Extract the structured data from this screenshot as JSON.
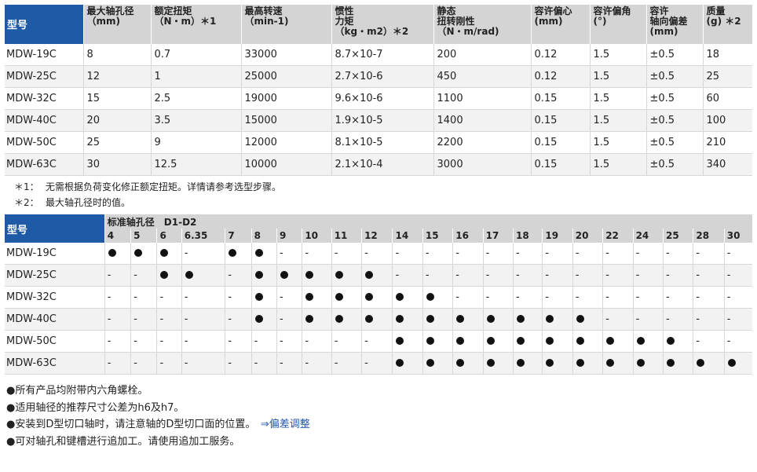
{
  "spec_table": {
    "headers": [
      {
        "line1": "型号",
        "line2": ""
      },
      {
        "line1": "最大轴孔径",
        "line2": "（mm)"
      },
      {
        "line1": "额定扭矩",
        "line2": "（N・m）＊1"
      },
      {
        "line1": "最高转速",
        "line2": "（min-1)"
      },
      {
        "line1": "惯性",
        "line2": "力矩",
        "line3": "（kg・m2）＊2"
      },
      {
        "line1": "静态",
        "line2": "扭转刚性",
        "line3": "（N・m/rad)"
      },
      {
        "line1": "容许偏心",
        "line2": "(mm)"
      },
      {
        "line1": "容许偏角",
        "line2": "(°)"
      },
      {
        "line1": "容许",
        "line2": "轴向偏差",
        "line3": "(mm)"
      },
      {
        "line1": "质量",
        "line2": "(g) ＊2"
      }
    ],
    "rows": [
      [
        "MDW-19C",
        "8",
        "0.7",
        "33000",
        "8.7×10-7",
        "200",
        "0.12",
        "1.5",
        "±0.5",
        "18"
      ],
      [
        "MDW-25C",
        "12",
        "1",
        "25000",
        "2.7×10-6",
        "450",
        "0.12",
        "1.5",
        "±0.5",
        "25"
      ],
      [
        "MDW-32C",
        "15",
        "2.5",
        "19000",
        "9.6×10-6",
        "1100",
        "0.15",
        "1.5",
        "±0.5",
        "60"
      ],
      [
        "MDW-40C",
        "20",
        "3.5",
        "15000",
        "1.9×10-5",
        "1400",
        "0.15",
        "1.5",
        "±0.5",
        "100"
      ],
      [
        "MDW-50C",
        "25",
        "9",
        "12000",
        "8.1×10-5",
        "2200",
        "0.15",
        "1.5",
        "±0.5",
        "210"
      ],
      [
        "MDW-63C",
        "30",
        "12.5",
        "10000",
        "2.1×10-4",
        "3000",
        "0.15",
        "1.5",
        "±0.5",
        "340"
      ]
    ]
  },
  "notes": [
    {
      "mark": "＊1：",
      "text": "无需根据负荷变化修正额定扭矩。详情请参考选型步骤。"
    },
    {
      "mark": "＊2：",
      "text": "最大轴孔径时的值。"
    }
  ],
  "bore_table": {
    "model_header": "型号",
    "group_header": "标准轴孔径　D1-D2",
    "sizes": [
      "4",
      "5",
      "6",
      "6.35",
      "7",
      "8",
      "9",
      "10",
      "11",
      "12",
      "14",
      "15",
      "16",
      "17",
      "18",
      "19",
      "20",
      "22",
      "24",
      "25",
      "28",
      "30"
    ],
    "rows": [
      {
        "model": "MDW-19C",
        "avail": [
          1,
          1,
          1,
          0,
          1,
          1,
          0,
          0,
          0,
          0,
          0,
          0,
          0,
          0,
          0,
          0,
          0,
          0,
          0,
          0,
          0,
          0
        ]
      },
      {
        "model": "MDW-25C",
        "avail": [
          0,
          0,
          1,
          1,
          0,
          1,
          1,
          1,
          1,
          1,
          0,
          0,
          0,
          0,
          0,
          0,
          0,
          0,
          0,
          0,
          0,
          0
        ]
      },
      {
        "model": "MDW-32C",
        "avail": [
          0,
          0,
          0,
          0,
          0,
          1,
          0,
          1,
          1,
          1,
          1,
          1,
          0,
          0,
          0,
          0,
          0,
          0,
          0,
          0,
          0,
          0
        ]
      },
      {
        "model": "MDW-40C",
        "avail": [
          0,
          0,
          0,
          0,
          0,
          1,
          0,
          1,
          1,
          1,
          1,
          1,
          1,
          1,
          1,
          1,
          1,
          0,
          0,
          0,
          0,
          0
        ]
      },
      {
        "model": "MDW-50C",
        "avail": [
          0,
          0,
          0,
          0,
          0,
          0,
          0,
          0,
          0,
          0,
          1,
          1,
          1,
          1,
          1,
          1,
          1,
          1,
          1,
          1,
          0,
          0
        ]
      },
      {
        "model": "MDW-63C",
        "avail": [
          0,
          0,
          0,
          0,
          0,
          0,
          0,
          0,
          0,
          0,
          1,
          1,
          1,
          1,
          1,
          1,
          1,
          1,
          1,
          1,
          1,
          1
        ]
      }
    ],
    "absent_mark": "-"
  },
  "bullets": [
    {
      "text": "●所有产品均附带内六角螺栓。"
    },
    {
      "text": "●适用轴径的推荐尺寸公差为h6及h7。"
    },
    {
      "text": "●安装到D型切口轴时，请注意轴的D型切口面的位置。",
      "link": "⇒偏差调整"
    },
    {
      "text": "●可对轴孔和键槽进行追加工。请使用追加工服务。"
    }
  ]
}
